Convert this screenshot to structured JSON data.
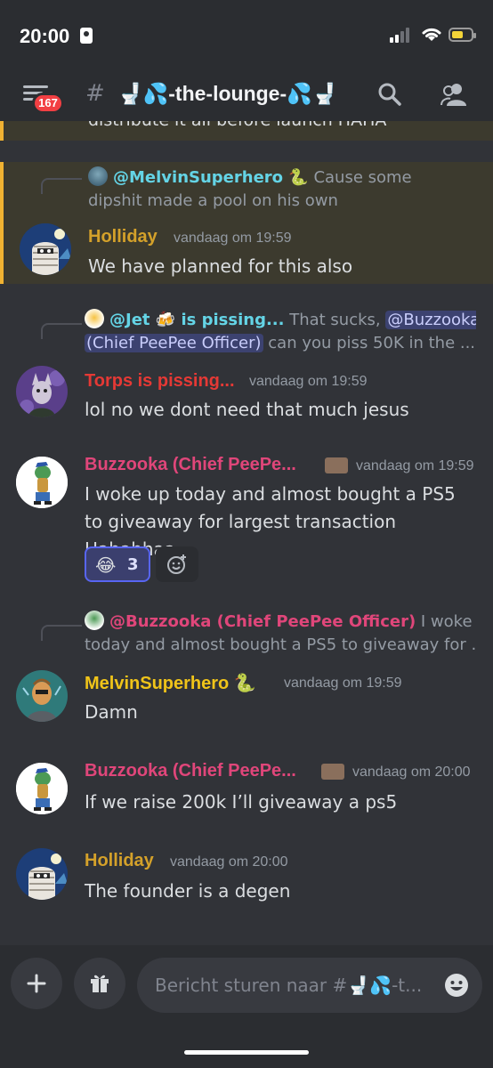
{
  "status_bar": {
    "time": "20:00"
  },
  "header": {
    "unread_badge": "167",
    "hash": "#",
    "channel_name": "🚽💦-the-lounge-💦🚽"
  },
  "messages": {
    "clipped_top_text": "distribute it all before launch HAHA",
    "m1": {
      "reply_author": "@MelvinSuperhero 🐍",
      "reply_text": "Cause some dipshit made a pool on his own",
      "author": "Holliday",
      "timestamp": "vandaag om 19:59",
      "text": "We have planned for this also"
    },
    "m2": {
      "reply_author": "@Jet 🍻 is pissing...",
      "reply_text_pre": "That sucks,",
      "reply_mention": "@Buzzooka (Chief PeePee Officer)",
      "reply_text_post": "can you piss 50K in the ...",
      "author": "Torps is pissing...",
      "timestamp": "vandaag om 19:59",
      "text": "lol no we dont need that much jesus"
    },
    "m3": {
      "author": "Buzzooka (Chief PeePe...",
      "timestamp": "vandaag om 19:59",
      "text": "I woke up today and almost bought a PS5 to giveaway for largest transaction Hahahhaa",
      "reaction_emoji": "😂",
      "reaction_count": "3"
    },
    "m4": {
      "reply_author": "@Buzzooka (Chief PeePee Officer)",
      "reply_text_line1": "I woke up",
      "reply_text_line2": "today and almost bought a PS5 to giveaway for ...",
      "author": "MelvinSuperhero 🐍",
      "timestamp": "vandaag om 19:59",
      "text": "Damn"
    },
    "m5": {
      "author": "Buzzooka (Chief PeePe...",
      "timestamp": "vandaag om 20:00",
      "text": "If we raise 200k I’ll giveaway a ps5"
    },
    "m6": {
      "author": "Holliday",
      "timestamp": "vandaag om 20:00",
      "text": "The founder is a degen"
    }
  },
  "composer": {
    "placeholder": "Bericht sturen naar #🚽💦-t..."
  },
  "colors": {
    "background": "#313338",
    "header_bg": "#2b2d31",
    "highlight_bg": "#3c3a2e",
    "highlight_border": "#f0b232",
    "holliday": "#d4a12a",
    "torps": "#e53935",
    "buzzooka": "#e0467a",
    "melvin": "#f0c419",
    "mention_teal": "#64d4e6",
    "reaction_border": "#5865f2"
  },
  "icons": [
    "menu-icon",
    "search-icon",
    "members-icon",
    "add-reaction-icon",
    "plus-icon",
    "gift-icon",
    "emoji-icon"
  ]
}
